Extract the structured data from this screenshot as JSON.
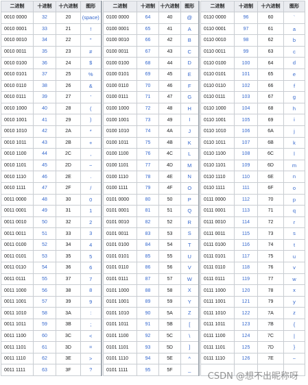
{
  "headers": [
    "二进制",
    "十进制",
    "十六进制",
    "图形"
  ],
  "groups": [
    [
      [
        "0010 0000",
        "32",
        "20",
        "(space)"
      ],
      [
        "0010 0001",
        "33",
        "21",
        "!"
      ],
      [
        "0010 0010",
        "34",
        "22",
        "\""
      ],
      [
        "0010 0011",
        "35",
        "23",
        "#"
      ],
      [
        "0010 0100",
        "36",
        "24",
        "$"
      ],
      [
        "0010 0101",
        "37",
        "25",
        "%"
      ],
      [
        "0010 0110",
        "38",
        "26",
        "&"
      ],
      [
        "0010 0111",
        "39",
        "27",
        "'"
      ],
      [
        "0010 1000",
        "40",
        "28",
        "("
      ],
      [
        "0010 1001",
        "41",
        "29",
        ")"
      ],
      [
        "0010 1010",
        "42",
        "2A",
        "*"
      ],
      [
        "0010 1011",
        "43",
        "2B",
        "+"
      ],
      [
        "0010 1100",
        "44",
        "2C",
        ","
      ],
      [
        "0010 1101",
        "45",
        "2D",
        "−"
      ],
      [
        "0010 1110",
        "46",
        "2E",
        "."
      ],
      [
        "0010 1111",
        "47",
        "2F",
        "/"
      ],
      [
        "0011 0000",
        "48",
        "30",
        "0"
      ],
      [
        "0011 0001",
        "49",
        "31",
        "1"
      ],
      [
        "0011 0010",
        "50",
        "32",
        "2"
      ],
      [
        "0011 0011",
        "51",
        "33",
        "3"
      ],
      [
        "0011 0100",
        "52",
        "34",
        "4"
      ],
      [
        "0011 0101",
        "53",
        "35",
        "5"
      ],
      [
        "0011 0110",
        "54",
        "36",
        "6"
      ],
      [
        "0011 0111",
        "55",
        "37",
        "7"
      ],
      [
        "0011 1000",
        "56",
        "38",
        "8"
      ],
      [
        "0011 1001",
        "57",
        "39",
        "9"
      ],
      [
        "0011 1010",
        "58",
        "3A",
        ":"
      ],
      [
        "0011 1011",
        "59",
        "3B",
        ";"
      ],
      [
        "0011 1100",
        "60",
        "3C",
        "<"
      ],
      [
        "0011 1101",
        "61",
        "3D",
        "="
      ],
      [
        "0011 1110",
        "62",
        "3E",
        ">"
      ],
      [
        "0011 1111",
        "63",
        "3F",
        "?"
      ]
    ],
    [
      [
        "0100 0000",
        "64",
        "40",
        "@"
      ],
      [
        "0100 0001",
        "65",
        "41",
        "A"
      ],
      [
        "0100 0010",
        "66",
        "42",
        "B"
      ],
      [
        "0100 0011",
        "67",
        "43",
        "C"
      ],
      [
        "0100 0100",
        "68",
        "44",
        "D"
      ],
      [
        "0100 0101",
        "69",
        "45",
        "E"
      ],
      [
        "0100 0110",
        "70",
        "46",
        "F"
      ],
      [
        "0100 0111",
        "71",
        "47",
        "G"
      ],
      [
        "0100 1000",
        "72",
        "48",
        "H"
      ],
      [
        "0100 1001",
        "73",
        "49",
        "I"
      ],
      [
        "0100 1010",
        "74",
        "4A",
        "J"
      ],
      [
        "0100 1011",
        "75",
        "4B",
        "K"
      ],
      [
        "0100 1100",
        "76",
        "4C",
        "L"
      ],
      [
        "0100 1101",
        "77",
        "4D",
        "M"
      ],
      [
        "0100 1110",
        "78",
        "4E",
        "N"
      ],
      [
        "0100 1111",
        "79",
        "4F",
        "O"
      ],
      [
        "0101 0000",
        "80",
        "50",
        "P"
      ],
      [
        "0101 0001",
        "81",
        "51",
        "Q"
      ],
      [
        "0101 0010",
        "82",
        "52",
        "R"
      ],
      [
        "0101 0011",
        "83",
        "53",
        "S"
      ],
      [
        "0101 0100",
        "84",
        "54",
        "T"
      ],
      [
        "0101 0101",
        "85",
        "55",
        "U"
      ],
      [
        "0101 0110",
        "86",
        "56",
        "V"
      ],
      [
        "0101 0111",
        "87",
        "57",
        "W"
      ],
      [
        "0101 1000",
        "88",
        "58",
        "X"
      ],
      [
        "0101 1001",
        "89",
        "59",
        "Y"
      ],
      [
        "0101 1010",
        "90",
        "5A",
        "Z"
      ],
      [
        "0101 1011",
        "91",
        "5B",
        "["
      ],
      [
        "0101 1100",
        "92",
        "5C",
        "\\"
      ],
      [
        "0101 1101",
        "93",
        "5D",
        "]"
      ],
      [
        "0101 1110",
        "94",
        "5E",
        "^"
      ],
      [
        "0101 1111",
        "95",
        "5F",
        "_"
      ]
    ],
    [
      [
        "0110 0000",
        "96",
        "60",
        "`"
      ],
      [
        "0110 0001",
        "97",
        "61",
        "a"
      ],
      [
        "0110 0010",
        "98",
        "62",
        "b"
      ],
      [
        "0110 0011",
        "99",
        "63",
        "c"
      ],
      [
        "0110 0100",
        "100",
        "64",
        "d"
      ],
      [
        "0110 0101",
        "101",
        "65",
        "e"
      ],
      [
        "0110 0110",
        "102",
        "66",
        "f"
      ],
      [
        "0110 0111",
        "103",
        "67",
        "g"
      ],
      [
        "0110 1000",
        "104",
        "68",
        "h"
      ],
      [
        "0110 1001",
        "105",
        "69",
        "i"
      ],
      [
        "0110 1010",
        "106",
        "6A",
        "j"
      ],
      [
        "0110 1011",
        "107",
        "6B",
        "k"
      ],
      [
        "0110 1100",
        "108",
        "6C",
        "l"
      ],
      [
        "0110 1101",
        "109",
        "6D",
        "m"
      ],
      [
        "0110 1110",
        "110",
        "6E",
        "n"
      ],
      [
        "0110 1111",
        "111",
        "6F",
        "o"
      ],
      [
        "0111 0000",
        "112",
        "70",
        "p"
      ],
      [
        "0111 0001",
        "113",
        "71",
        "q"
      ],
      [
        "0111 0010",
        "114",
        "72",
        "r"
      ],
      [
        "0111 0011",
        "115",
        "73",
        "s"
      ],
      [
        "0111 0100",
        "116",
        "74",
        "t"
      ],
      [
        "0111 0101",
        "117",
        "75",
        "u"
      ],
      [
        "0111 0110",
        "118",
        "76",
        "v"
      ],
      [
        "0111 0111",
        "119",
        "77",
        "w"
      ],
      [
        "0111 1000",
        "120",
        "78",
        "x"
      ],
      [
        "0111 1001",
        "121",
        "79",
        "y"
      ],
      [
        "0111 1010",
        "122",
        "7A",
        "z"
      ],
      [
        "0111 1011",
        "123",
        "7B",
        "{"
      ],
      [
        "0111 1100",
        "124",
        "7C",
        "|"
      ],
      [
        "0111 1101",
        "125",
        "7D",
        "}"
      ],
      [
        "0111 1110",
        "126",
        "7E",
        "~"
      ]
    ]
  ],
  "watermark": "CSDN @想不出昵称呀"
}
